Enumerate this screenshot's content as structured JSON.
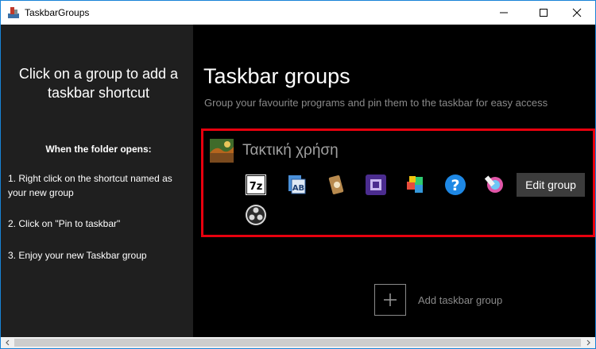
{
  "window": {
    "title": "TaskbarGroups",
    "accent": "#1883d7"
  },
  "left_panel": {
    "title": "Click on a group to add a taskbar shortcut",
    "subhead": "When the folder opens:",
    "steps": [
      "1. Right click on the shortcut named as your new group",
      "2. Click on \"Pin to taskbar\"",
      "3. Enjoy your new Taskbar group"
    ]
  },
  "main": {
    "title": "Taskbar groups",
    "subtitle": "Group your favourite programs and pin them to the taskbar for easy access",
    "group": {
      "name": "Τακτική χρήση",
      "highlight_color": "#e8000e",
      "edit_label": "Edit group",
      "programs": [
        "7zip-icon",
        "text-editor-icon",
        "scroll-app-icon",
        "cpu-chip-icon",
        "cube-blocks-icon",
        "help-question-icon",
        "color-pen-icon",
        "obs-studio-icon"
      ]
    },
    "add_group_label": "Add taskbar group"
  }
}
